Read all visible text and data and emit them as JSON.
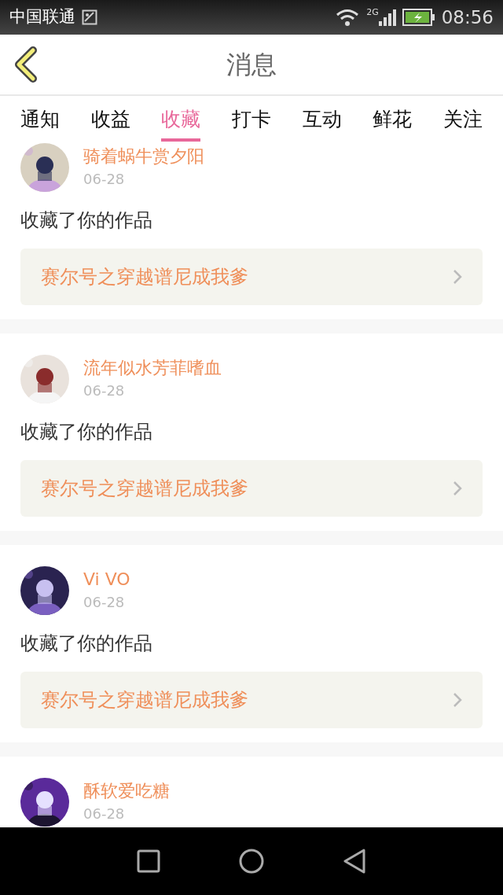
{
  "status_bar": {
    "carrier": "中国联通",
    "network": "2G",
    "time": "08:56"
  },
  "header": {
    "title": "消息"
  },
  "tabs": [
    {
      "label": "通知",
      "selected": false
    },
    {
      "label": "收益",
      "selected": false
    },
    {
      "label": "收藏",
      "selected": true
    },
    {
      "label": "打卡",
      "selected": false
    },
    {
      "label": "互动",
      "selected": false
    },
    {
      "label": "鲜花",
      "selected": false
    },
    {
      "label": "关注",
      "selected": false
    }
  ],
  "messages": [
    {
      "name": "骑着蜗牛赏夕阳",
      "date": "06-28",
      "action": "收藏了你的作品",
      "work": "赛尔号之穿越谱尼成我爹"
    },
    {
      "name": "流年似水芳菲嗜血",
      "date": "06-28",
      "action": "收藏了你的作品",
      "work": "赛尔号之穿越谱尼成我爹"
    },
    {
      "name": "Vi VO",
      "date": "06-28",
      "action": "收藏了你的作品",
      "work": "赛尔号之穿越谱尼成我爹"
    },
    {
      "name": "酥软爱吃糖",
      "date": "06-28"
    }
  ]
}
